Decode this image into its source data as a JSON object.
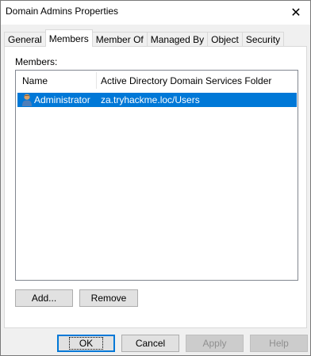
{
  "window": {
    "title": "Domain Admins Properties",
    "close_glyph": "✕"
  },
  "tabs": [
    "General",
    "Members",
    "Member Of",
    "Managed By",
    "Object",
    "Security"
  ],
  "active_tab": "Members",
  "members": {
    "label": "Members:",
    "columns": {
      "name": "Name",
      "folder": "Active Directory Domain Services Folder"
    },
    "rows": [
      {
        "name": "Administrator",
        "folder": "za.tryhackme.loc/Users",
        "icon": "user-icon",
        "selected": true
      }
    ]
  },
  "buttons": {
    "add": "Add...",
    "remove": "Remove",
    "ok": "OK",
    "cancel": "Cancel",
    "apply": "Apply",
    "help": "Help"
  },
  "colors": {
    "selection": "#0078d7",
    "focus_border": "#0078d7"
  }
}
